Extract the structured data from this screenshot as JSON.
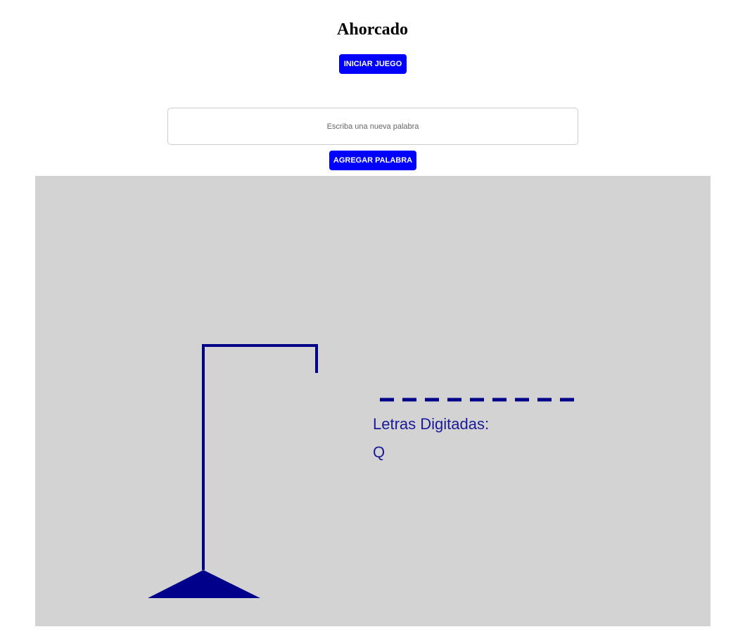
{
  "header": {
    "title": "Ahorcado"
  },
  "controls": {
    "start_label": "INICIAR JUEGO",
    "add_label": "AGREGAR PALABRA",
    "word_input": {
      "placeholder": "Escriba una nueva palabra",
      "value": ""
    }
  },
  "game": {
    "word_length": 9,
    "guessed_word": [
      "",
      "",
      "",
      "",
      "",
      "",
      "",
      "",
      ""
    ],
    "typed_label": "Letras Digitadas:",
    "typed_letters": "Q",
    "mistakes": 1
  },
  "colors": {
    "button_bg": "#0000ff",
    "board_bg": "#d3d3d3",
    "ink": "#00008b",
    "text_ink": "#1a1a99"
  }
}
